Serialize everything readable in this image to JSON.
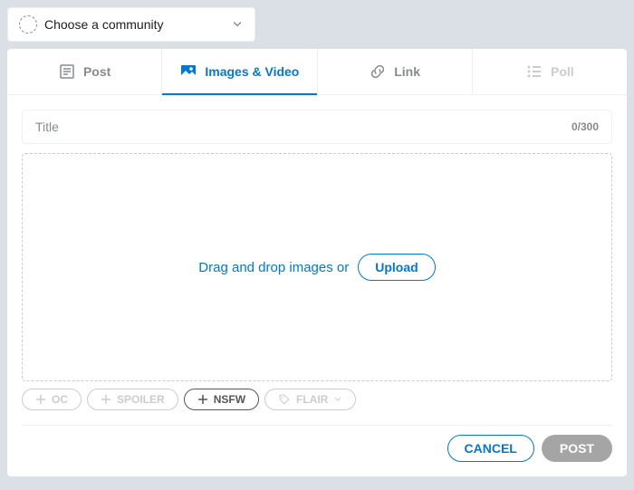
{
  "community": {
    "placeholder": "Choose a community"
  },
  "tabs": {
    "post": "Post",
    "images": "Images & Video",
    "link": "Link",
    "poll": "Poll"
  },
  "title_field": {
    "placeholder": "Title",
    "count": "0/300"
  },
  "dropzone": {
    "text": "Drag and drop images or",
    "upload": "Upload"
  },
  "tags": {
    "oc": "OC",
    "spoiler": "SPOILER",
    "nsfw": "NSFW",
    "flair": "FLAIR"
  },
  "footer": {
    "cancel": "CANCEL",
    "post": "POST"
  }
}
